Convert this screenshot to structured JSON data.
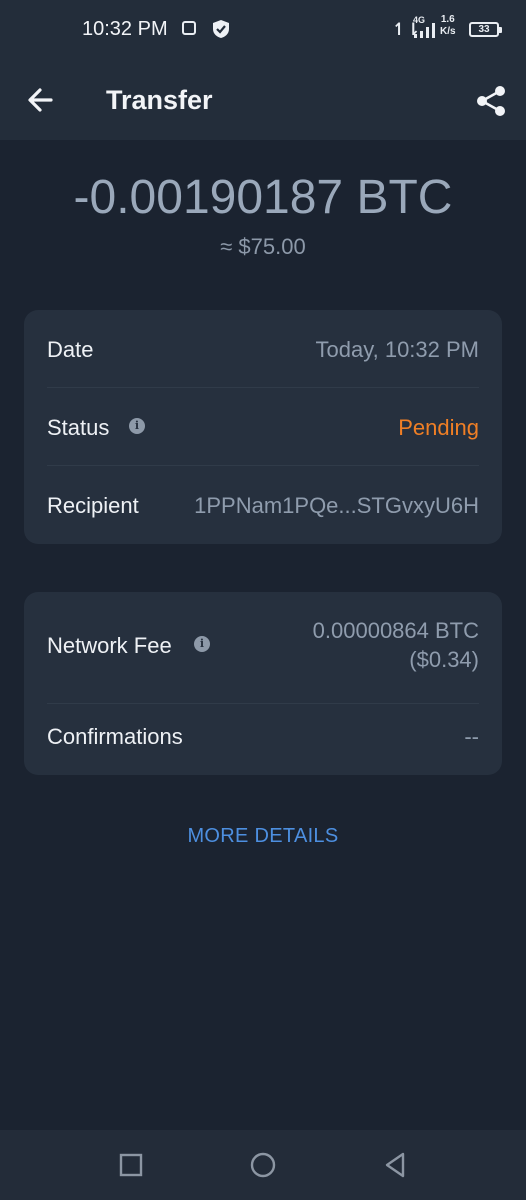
{
  "status_bar": {
    "time": "10:32 PM",
    "network_arrows": "↿⇂",
    "network_type": "4G",
    "speed_value": "1.6",
    "speed_unit": "K/s",
    "battery": "33"
  },
  "header": {
    "title": "Transfer",
    "back_icon": "arrow-left-icon",
    "share_icon": "share-icon"
  },
  "summary": {
    "amount": "-0.00190187 BTC",
    "fiat": "≈ $75.00"
  },
  "details": {
    "date_label": "Date",
    "date_value": "Today, 10:32 PM",
    "status_label": "Status",
    "status_value": "Pending",
    "recipient_label": "Recipient",
    "recipient_value": "1PPNam1PQe...STGvxyU6H"
  },
  "fees": {
    "network_fee_label": "Network Fee",
    "network_fee_value": "0.00000864 BTC",
    "network_fee_fiat": "($0.34)",
    "confirmations_label": "Confirmations",
    "confirmations_value": "--"
  },
  "more_details": "MORE DETAILS",
  "colors": {
    "background": "#1b2330",
    "card": "#26303e",
    "pending": "#f07f25",
    "link": "#4d8fe0"
  },
  "nav_bar": {
    "icons": [
      "square-recents-icon",
      "circle-home-icon",
      "triangle-back-icon"
    ]
  }
}
